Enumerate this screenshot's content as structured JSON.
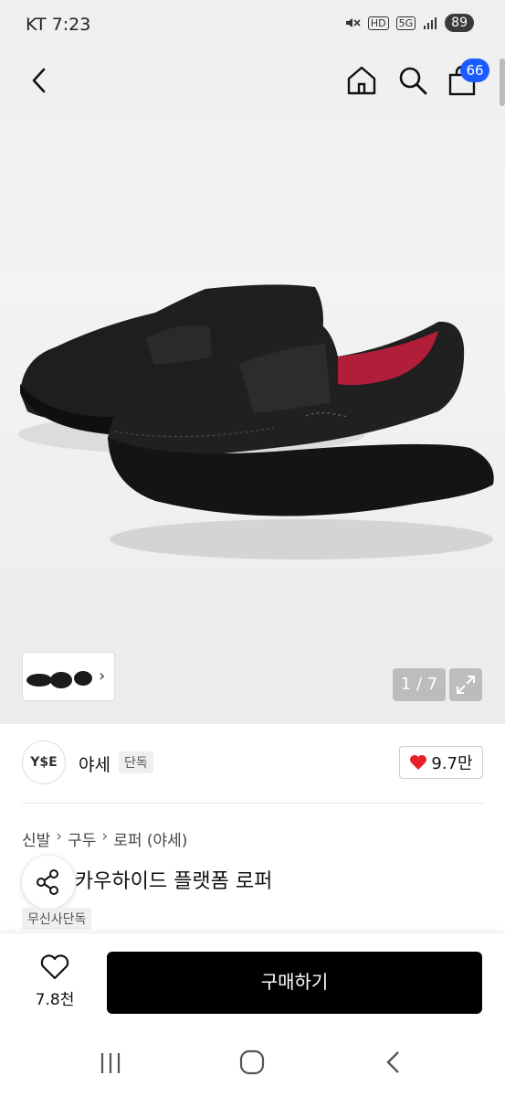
{
  "status_bar": {
    "carrier_time": "KT 7:23",
    "hd_label": "HD",
    "network_label": "5G",
    "battery": "89"
  },
  "top_nav": {
    "cart_count": "66"
  },
  "gallery": {
    "page_indicator": "1 / 7"
  },
  "brand": {
    "logo_text": "Y$E",
    "name": "야세",
    "tag": "단독",
    "likes": "9.7만"
  },
  "breadcrumb": [
    "신발",
    "구두",
    "로퍼 (야세)"
  ],
  "product": {
    "title": "[TRY]카우하이드 플랫폼 로퍼",
    "badge": "무신사단독"
  },
  "bottom_bar": {
    "wish_count": "7.8천",
    "buy_label": "구매하기"
  },
  "colors": {
    "badge_blue": "#1a5cff",
    "heart_red": "#e8202a",
    "buy_button": "#000000"
  },
  "icons": [
    "back-icon",
    "home-icon",
    "search-icon",
    "bag-icon",
    "chevron-right-icon",
    "expand-icon",
    "heart-icon",
    "share-icon",
    "nav-recent-icon",
    "nav-home-icon",
    "nav-back-icon"
  ]
}
